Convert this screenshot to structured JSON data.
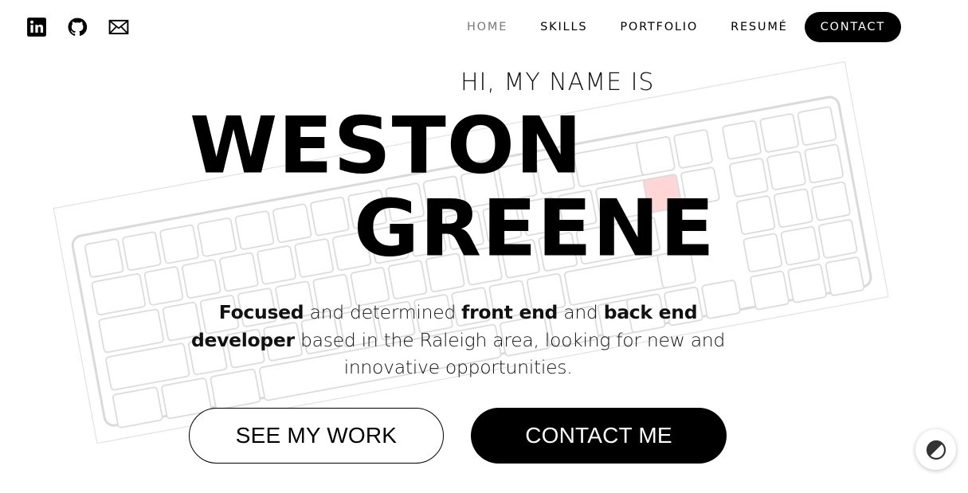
{
  "social": {
    "linkedin_icon": "linkedin-icon",
    "github_icon": "github-icon",
    "email_icon": "mail-icon"
  },
  "nav": {
    "items": [
      "HOME",
      "SKILLS",
      "PORTFOLIO",
      "RESUMÉ"
    ],
    "contact": "CONTACT"
  },
  "hero": {
    "greeting": "HI, MY NAME IS",
    "first_name": "WESTON",
    "last_name": "GREENE",
    "intro": [
      {
        "text": "Focused",
        "bold": true
      },
      {
        "text": " and determined ",
        "bold": false
      },
      {
        "text": "front end",
        "bold": true
      },
      {
        "text": " and ",
        "bold": false
      },
      {
        "text": "back end developer",
        "bold": true
      },
      {
        "text": " based in the Raleigh area, looking for new and innovative opportunities.",
        "bold": false
      }
    ]
  },
  "buttons": {
    "see_work": "SEE MY WORK",
    "contact_me": "CONTACT ME"
  },
  "theme_toggle": {
    "icon": "contrast-icon"
  },
  "colors": {
    "primary": "#000000",
    "background": "#ffffff",
    "muted": "#777777",
    "accent_key": "#ffd6d6"
  }
}
